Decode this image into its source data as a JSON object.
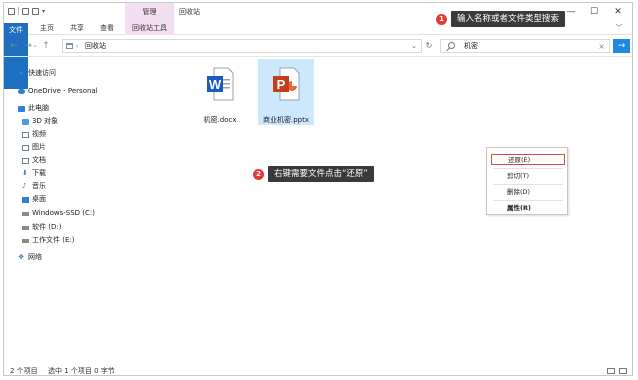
{
  "titlebar": {
    "ribbon_context": "管理",
    "title": "回收站",
    "minimize": "—",
    "maximize": "☐",
    "close": "✕"
  },
  "ribbon": {
    "file": "文件",
    "home": "主页",
    "share": "共享",
    "view": "查看",
    "tools": "回收站工具",
    "expand": "﹀"
  },
  "nav_buttons": {
    "back": "←",
    "forward": "→",
    "up": "↑"
  },
  "address": {
    "separator": "›",
    "path": "回收站",
    "dropdown": "⌄",
    "refresh": "↻"
  },
  "search": {
    "value": "机密",
    "clear": "×",
    "go": "→"
  },
  "sidebar": {
    "quick_access": "快速访问",
    "onedrive": "OneDrive - Personal",
    "this_pc": "此电脑",
    "objects_3d": "3D 对象",
    "videos": "视频",
    "pictures": "图片",
    "documents": "文档",
    "downloads": "下载",
    "music": "音乐",
    "desktop": "桌面",
    "drive_c": "Windows-SSD (C:)",
    "drive_d": "软件 (D:)",
    "drive_e": "工作文件 (E:)",
    "network": "网络"
  },
  "files": [
    {
      "name": "机密.docx",
      "icon_letter": "W",
      "color": "#185abd"
    },
    {
      "name": "商业机密.pptx",
      "icon_letter": "P",
      "color": "#c43e1c"
    }
  ],
  "context_menu": {
    "restore": "还原(E)",
    "cut": "剪切(T)",
    "delete": "删除(D)",
    "properties": "属性(R)"
  },
  "callouts": [
    {
      "number": "1",
      "text": "输入名称或者文件类型搜索"
    },
    {
      "number": "2",
      "text": "右键需要文件点击“还原”"
    }
  ],
  "status": {
    "count": "2 个项目",
    "selected": "选中 1 个项目  0 字节"
  },
  "colors": {
    "accent": "#1e88e5",
    "ribbon_file": "#1e6fbf",
    "context_tab": "#f3dff2",
    "highlight": "#e04848",
    "selection": "#cce8ff"
  }
}
